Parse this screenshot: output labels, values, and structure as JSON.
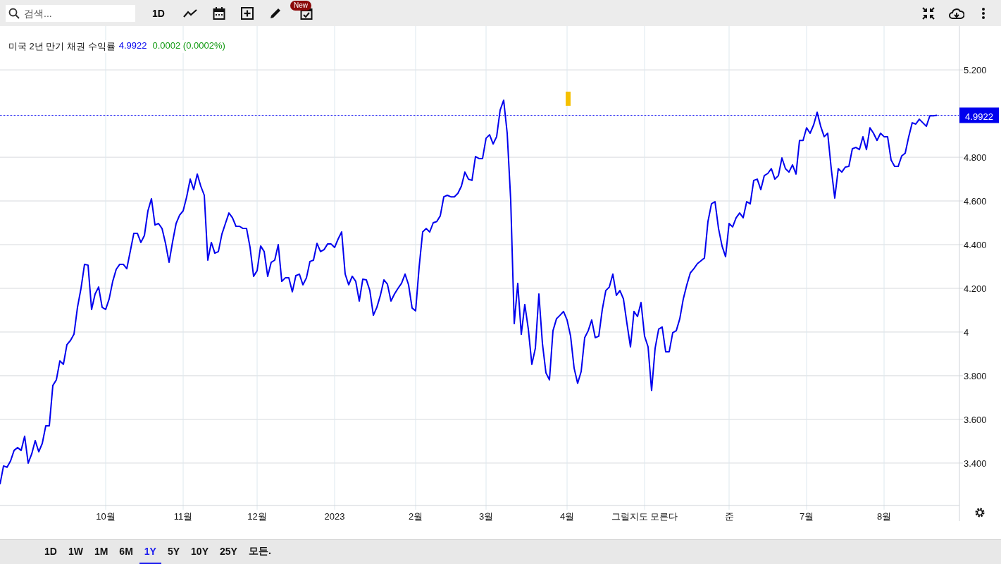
{
  "toolbar": {
    "search": {
      "placeholder": "검색..."
    },
    "interval": "1D",
    "badge": "New"
  },
  "legend": {
    "price": "4.9922",
    "change": "0.0002 (0.0002%)"
  },
  "chart_data": {
    "type": "line",
    "grid": true,
    "ref_lines": [
      {
        "axis": "y",
        "value": 4.9922,
        "label": "4.9922",
        "color": "#0000ee"
      }
    ],
    "ylim": [
      3.206,
      5.394
    ],
    "categories": [
      null,
      null,
      null,
      null,
      null,
      null,
      null,
      null,
      null,
      null,
      null,
      null,
      null,
      null,
      null,
      null,
      null,
      null,
      null,
      null,
      null,
      null,
      null,
      null,
      null,
      null,
      null,
      null,
      null,
      null,
      "10월",
      null,
      null,
      null,
      null,
      null,
      null,
      null,
      null,
      null,
      null,
      null,
      null,
      null,
      null,
      null,
      null,
      null,
      null,
      null,
      null,
      null,
      "11월",
      null,
      null,
      null,
      null,
      null,
      null,
      null,
      null,
      null,
      null,
      null,
      null,
      null,
      null,
      null,
      null,
      null,
      null,
      null,
      null,
      "12월",
      null,
      null,
      null,
      null,
      null,
      null,
      null,
      null,
      null,
      null,
      null,
      null,
      null,
      null,
      null,
      null,
      null,
      null,
      null,
      null,
      null,
      "2023",
      null,
      null,
      null,
      null,
      null,
      null,
      null,
      null,
      null,
      null,
      null,
      null,
      null,
      null,
      null,
      null,
      null,
      null,
      null,
      null,
      null,
      null,
      "2월",
      null,
      null,
      null,
      null,
      null,
      null,
      null,
      null,
      null,
      null,
      null,
      null,
      null,
      null,
      null,
      null,
      null,
      null,
      null,
      "3월",
      null,
      null,
      null,
      null,
      null,
      null,
      null,
      null,
      null,
      null,
      null,
      null,
      null,
      null,
      null,
      null,
      null,
      null,
      null,
      null,
      null,
      null,
      "4월",
      null,
      null,
      null,
      null,
      null,
      null,
      null,
      null,
      null,
      null,
      null,
      null,
      null,
      null,
      null,
      null,
      null,
      null,
      null,
      null,
      null,
      "그럴지도 모른다",
      null,
      null,
      null,
      null,
      null,
      null,
      null,
      null,
      null,
      null,
      null,
      null,
      null,
      null,
      null,
      null,
      null,
      null,
      null,
      null,
      null,
      null,
      null,
      "준",
      null,
      null,
      null,
      null,
      null,
      null,
      null,
      null,
      null,
      null,
      null,
      null,
      null,
      null,
      null,
      null,
      null,
      null,
      null,
      null,
      null,
      "7월",
      null,
      null,
      null,
      null,
      null,
      null,
      null,
      null,
      null,
      null,
      null,
      null,
      null,
      null,
      null,
      null,
      null,
      null,
      null,
      null,
      null,
      "8월",
      null,
      null,
      null,
      null,
      null,
      null,
      null,
      null,
      null,
      null,
      null,
      null,
      null,
      null,
      null
    ],
    "yticks": [
      {
        "value": 3.4,
        "label": "3.400"
      },
      {
        "value": 3.6,
        "label": "3.600"
      },
      {
        "value": 3.8,
        "label": "3.800"
      },
      {
        "value": 4,
        "label": "4"
      },
      {
        "value": 4.2,
        "label": "4.200"
      },
      {
        "value": 4.4,
        "label": "4.400"
      },
      {
        "value": 4.6,
        "label": "4.600"
      },
      {
        "value": 4.8,
        "label": "4.800"
      },
      {
        "value": 5.2,
        "label": "5.200"
      }
    ],
    "series": [
      {
        "name": "미국 2년 만기 채권 수익률",
        "color": "#0000ee",
        "values": [
          3.303,
          3.387,
          3.381,
          3.41,
          3.458,
          3.471,
          3.458,
          3.523,
          3.4,
          3.442,
          3.503,
          3.452,
          3.49,
          3.571,
          3.571,
          3.755,
          3.781,
          3.868,
          3.852,
          3.942,
          3.961,
          3.99,
          4.113,
          4.2,
          4.31,
          4.306,
          4.103,
          4.174,
          4.206,
          4.113,
          4.103,
          4.152,
          4.232,
          4.287,
          4.31,
          4.31,
          4.29,
          4.371,
          4.452,
          4.452,
          4.41,
          4.442,
          4.555,
          4.61,
          4.49,
          4.497,
          4.474,
          4.406,
          4.319,
          4.413,
          4.497,
          4.535,
          4.555,
          4.619,
          4.7,
          4.652,
          4.723,
          4.668,
          4.626,
          4.329,
          4.41,
          4.361,
          4.368,
          4.448,
          4.497,
          4.545,
          4.523,
          4.484,
          4.484,
          4.474,
          4.474,
          4.387,
          4.255,
          4.281,
          4.394,
          4.368,
          4.255,
          4.319,
          4.329,
          4.4,
          4.232,
          4.248,
          4.248,
          4.184,
          4.258,
          4.265,
          4.216,
          4.248,
          4.323,
          4.329,
          4.406,
          4.368,
          4.377,
          4.403,
          4.403,
          4.387,
          4.426,
          4.458,
          4.265,
          4.216,
          4.255,
          4.232,
          4.142,
          4.242,
          4.239,
          4.19,
          4.077,
          4.113,
          4.168,
          4.239,
          4.219,
          4.142,
          4.174,
          4.2,
          4.223,
          4.265,
          4.216,
          4.11,
          4.097,
          4.297,
          4.458,
          4.474,
          4.458,
          4.5,
          4.506,
          4.532,
          4.619,
          4.626,
          4.619,
          4.619,
          4.635,
          4.668,
          4.732,
          4.7,
          4.694,
          4.803,
          4.794,
          4.794,
          4.887,
          4.903,
          4.861,
          4.894,
          5.016,
          5.061,
          4.91,
          4.603,
          4.039,
          4.223,
          3.99,
          4.126,
          4.013,
          3.852,
          3.926,
          4.174,
          3.948,
          3.813,
          3.781,
          4.006,
          4.061,
          4.077,
          4.094,
          4.055,
          3.981,
          3.835,
          3.765,
          3.819,
          3.974,
          4.006,
          4.055,
          3.974,
          3.981,
          4.103,
          4.19,
          4.206,
          4.265,
          4.168,
          4.19,
          4.152,
          4.039,
          3.932,
          4.094,
          4.071,
          4.135,
          3.981,
          3.932,
          3.732,
          3.926,
          4.013,
          4.023,
          3.91,
          3.91,
          3.997,
          4.006,
          4.061,
          4.152,
          4.216,
          4.271,
          4.29,
          4.313,
          4.326,
          4.339,
          4.506,
          4.587,
          4.597,
          4.474,
          4.394,
          4.345,
          4.497,
          4.481,
          4.523,
          4.545,
          4.523,
          4.597,
          4.587,
          4.694,
          4.7,
          4.652,
          4.716,
          4.726,
          4.748,
          4.7,
          4.716,
          4.797,
          4.748,
          4.732,
          4.765,
          4.723,
          4.877,
          4.877,
          4.935,
          4.91,
          4.948,
          5.006,
          4.942,
          4.894,
          4.91,
          4.748,
          4.613,
          4.748,
          4.732,
          4.755,
          4.758,
          4.839,
          4.845,
          4.835,
          4.894,
          4.835,
          4.935,
          4.91,
          4.877,
          4.91,
          4.894,
          4.894,
          4.787,
          4.758,
          4.758,
          4.806,
          4.819,
          4.894,
          4.958,
          4.952,
          4.974,
          4.958,
          4.942,
          4.99,
          4.99,
          4.992
        ]
      }
    ]
  },
  "ranges": [
    {
      "label": "1D",
      "selected": false
    },
    {
      "label": "1W",
      "selected": false
    },
    {
      "label": "1M",
      "selected": false
    },
    {
      "label": "6M",
      "selected": false
    },
    {
      "label": "1Y",
      "selected": true
    },
    {
      "label": "5Y",
      "selected": false
    },
    {
      "label": "10Y",
      "selected": false
    },
    {
      "label": "25Y",
      "selected": false
    },
    {
      "label": "모든.",
      "selected": false
    }
  ]
}
